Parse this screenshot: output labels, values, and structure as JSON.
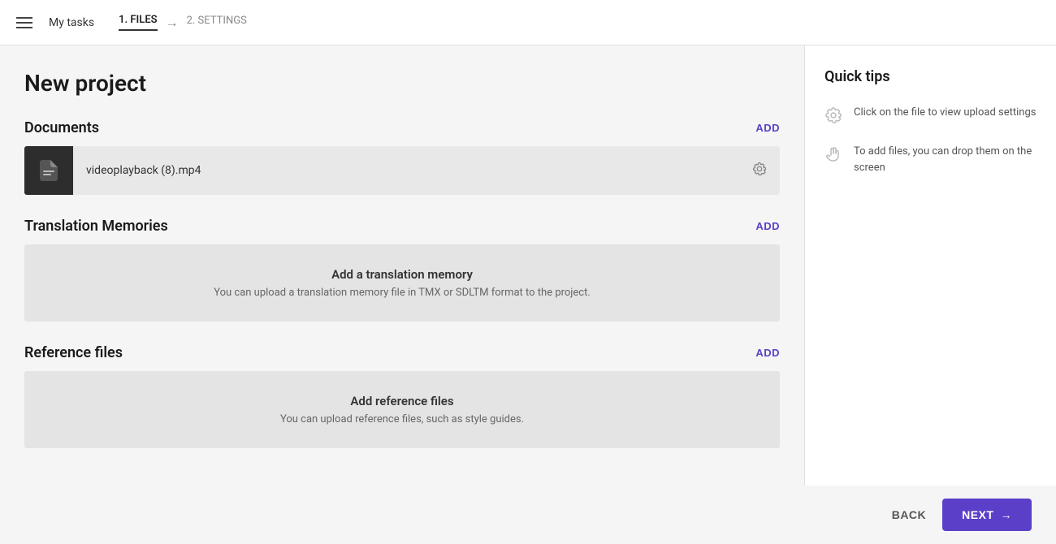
{
  "header": {
    "hamburger_label": "menu",
    "my_tasks": "My tasks",
    "step1_label": "1. FILES",
    "arrow": "→",
    "step2_label": "2. SETTINGS"
  },
  "page": {
    "title": "New project"
  },
  "documents": {
    "section_title": "Documents",
    "add_label": "ADD",
    "file": {
      "name": "videoplayback (8).mp4"
    }
  },
  "translation_memories": {
    "section_title": "Translation Memories",
    "add_label": "ADD",
    "empty_title": "Add a translation memory",
    "empty_desc": "You can upload a translation memory file in TMX or SDLTM format to the project."
  },
  "reference_files": {
    "section_title": "Reference files",
    "add_label": "ADD",
    "empty_title": "Add reference files",
    "empty_desc": "You can upload reference files, such as style guides."
  },
  "footer": {
    "back_label": "BACK",
    "next_label": "NEXT"
  },
  "quick_tips": {
    "title": "Quick tips",
    "tips": [
      {
        "icon": "gear-icon",
        "text": "Click on the file to view upload settings"
      },
      {
        "icon": "hand-icon",
        "text": "To add files, you can drop them on the screen"
      }
    ]
  }
}
